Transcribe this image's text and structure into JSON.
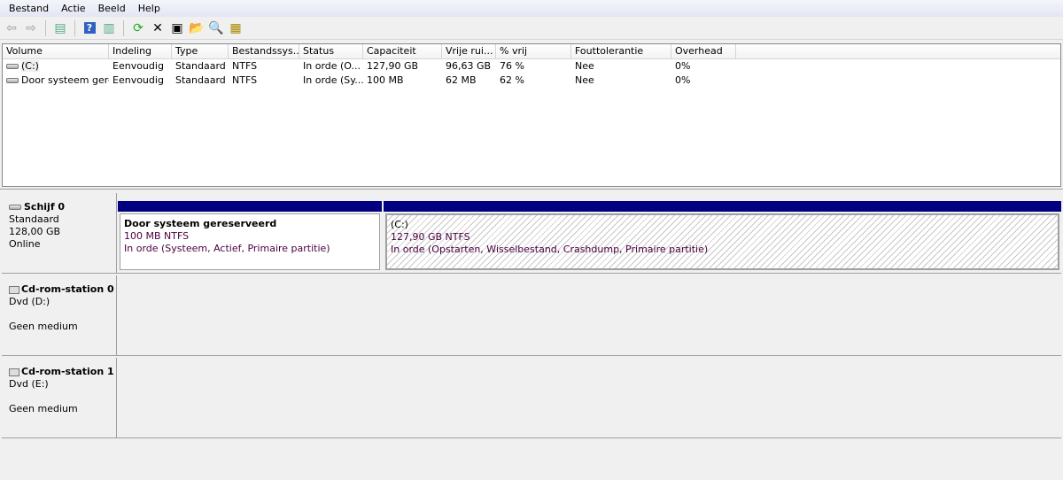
{
  "menu": [
    "Bestand",
    "Actie",
    "Beeld",
    "Help"
  ],
  "columns": [
    "Volume",
    "Indeling",
    "Type",
    "Bestandssys...",
    "Status",
    "Capaciteit",
    "Vrije rui...",
    "% vrij",
    "Fouttolerantie",
    "Overhead"
  ],
  "volumes": [
    [
      "(C:)",
      "Eenvoudig",
      "Standaard",
      "NTFS",
      "In orde (O...",
      "127,90 GB",
      "96,63 GB",
      "76 %",
      "Nee",
      "0%"
    ],
    [
      "Door systeem gere...",
      "Eenvoudig",
      "Standaard",
      "NTFS",
      "In orde (Sy...",
      "100 MB",
      "62 MB",
      "62 %",
      "Nee",
      "0%"
    ]
  ],
  "disks": [
    {
      "name": "Schijf 0",
      "type": "Standaard",
      "size": "128,00 GB",
      "state": "Online",
      "partitions": [
        {
          "name": "Door systeem gereserveerd",
          "size": "100 MB NTFS",
          "status": "In orde (Systeem, Actief, Primaire partitie)"
        },
        {
          "name": "(C:)",
          "size": "127,90 GB NTFS",
          "status": "In orde (Opstarten, Wisselbestand, Crashdump, Primaire partitie)"
        }
      ]
    },
    {
      "name": "Cd-rom-station 0",
      "type": "Dvd (D:)",
      "state": "Geen medium"
    },
    {
      "name": "Cd-rom-station 1",
      "type": "Dvd (E:)",
      "state": "Geen medium"
    }
  ],
  "colors": {
    "partition_bar": "#000080",
    "partition_text": "#4b0040"
  }
}
